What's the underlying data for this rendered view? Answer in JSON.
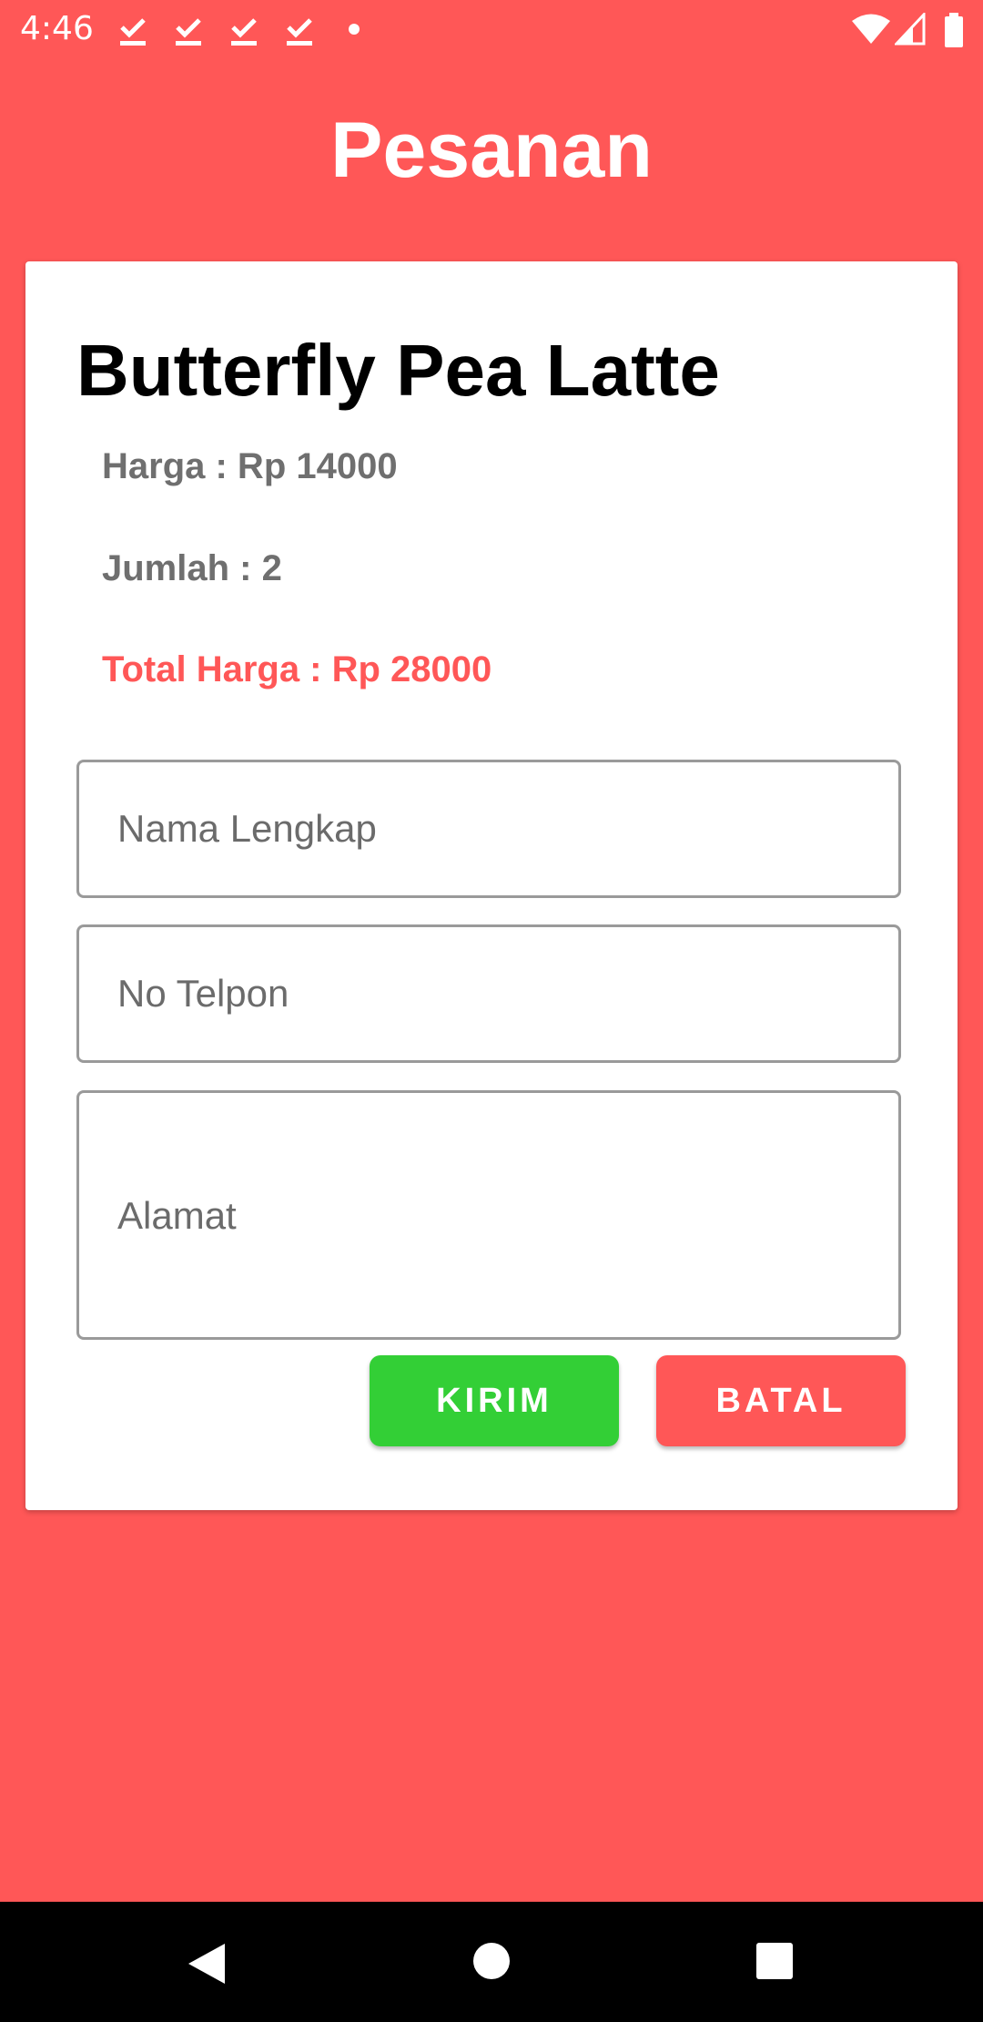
{
  "status_bar": {
    "time": "4:46",
    "notification_icons": [
      "download-done-icon",
      "download-done-icon",
      "download-done-icon",
      "download-done-icon"
    ],
    "system_icons": [
      "wifi-icon",
      "signal-icon",
      "battery-icon"
    ]
  },
  "header": {
    "title": "Pesanan"
  },
  "order": {
    "product_name": "Butterfly Pea Latte",
    "price_text": "Harga : Rp 14000",
    "quantity_text": "Jumlah :  2",
    "total_text": "Total Harga : Rp 28000"
  },
  "form": {
    "name_placeholder": "Nama Lengkap",
    "phone_placeholder": "No Telpon",
    "address_placeholder": "Alamat",
    "name_value": "",
    "phone_value": "",
    "address_value": ""
  },
  "buttons": {
    "send_label": "KIRIM",
    "cancel_label": "BATAL"
  },
  "nav_bar": {
    "icons": [
      "back-icon",
      "home-icon",
      "recents-icon"
    ]
  },
  "colors": {
    "background": "#FF5757",
    "send_button": "#33CF36",
    "cancel_button": "#FF5757",
    "total_text": "#FF5757"
  }
}
